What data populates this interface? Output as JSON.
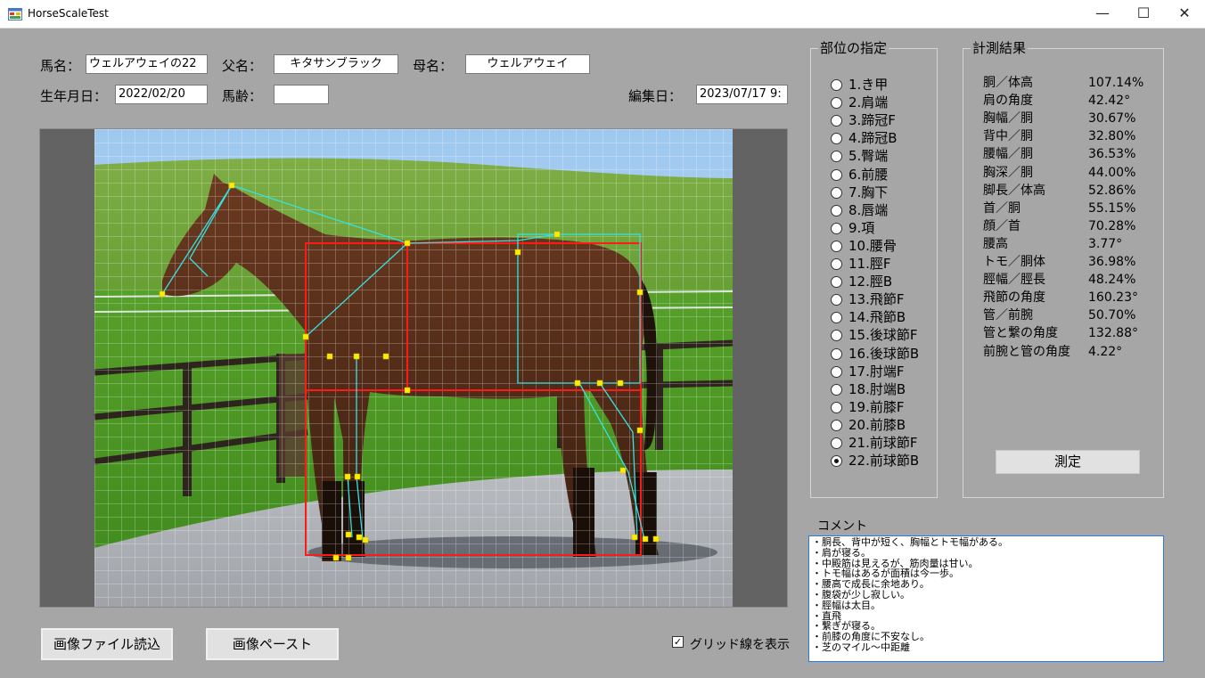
{
  "window": {
    "title": "HorseScaleTest",
    "minimize": "—",
    "maximize": "☐",
    "close": "✕"
  },
  "header": {
    "horse_name_label": "馬名：",
    "horse_name": "ウェルアウェイの22",
    "sire_label": "父名：",
    "sire": "キタサンブラック",
    "dam_label": "母名：",
    "dam": "ウェルアウェイ",
    "birth_label": "生年月日：",
    "birth": "2022/02/20",
    "age_label": "馬齢：",
    "age": "",
    "edit_label": "編集日：",
    "edit_date": "2023/07/17 9:"
  },
  "parts": {
    "title": "部位の指定",
    "selected_index": 21,
    "items": [
      "1.き甲",
      "2.肩端",
      "3.蹄冠F",
      "4.蹄冠B",
      "5.臀端",
      "6.前腰",
      "7.胸下",
      "8.唇端",
      "9.項",
      "10.腰骨",
      "11.脛F",
      "12.脛B",
      "13.飛節F",
      "14.飛節B",
      "15.後球節F",
      "16.後球節B",
      "17.肘端F",
      "18.肘端B",
      "19.前膝F",
      "20.前膝B",
      "21.前球節F",
      "22.前球節B"
    ]
  },
  "results": {
    "title": "計測結果",
    "rows": [
      {
        "name": "胴／体高",
        "value": "107.14%"
      },
      {
        "name": "肩の角度",
        "value": "42.42°"
      },
      {
        "name": "胸幅／胴",
        "value": "30.67%"
      },
      {
        "name": "背中／胴",
        "value": "32.80%"
      },
      {
        "name": "腰幅／胴",
        "value": "36.53%"
      },
      {
        "name": "胸深／胴",
        "value": "44.00%"
      },
      {
        "name": "脚長／体高",
        "value": "52.86%"
      },
      {
        "name": "首／胴",
        "value": "55.15%"
      },
      {
        "name": "顔／首",
        "value": "70.28%"
      },
      {
        "name": "腰高",
        "value": "3.77°"
      },
      {
        "name": "トモ／胴体",
        "value": "36.98%"
      },
      {
        "name": "脛幅／脛長",
        "value": "48.24%"
      },
      {
        "name": "飛節の角度",
        "value": "160.23°"
      },
      {
        "name": "管／前腕",
        "value": "50.70%"
      },
      {
        "name": "管と繋の角度",
        "value": "132.88°"
      },
      {
        "name": "前腕と管の角度",
        "value": "4.22°"
      }
    ],
    "measure_button": "測定"
  },
  "comment": {
    "label": "コメント",
    "lines": [
      "・胴長、背中が短く、胸幅とトモ幅がある。",
      "・肩が寝る。",
      "・中殿筋は見えるが、筋肉量は甘い。",
      "・トモ幅はあるが面積は今一歩。",
      "・腰高で成長に余地あり。",
      "・腹袋が少し寂しい。",
      "・脛幅は太目。",
      "・直飛",
      "・繋ぎが寝る。",
      "・前膝の角度に不安なし。",
      "・芝のマイル～中距離"
    ]
  },
  "bottom": {
    "load_file_button": "画像ファイル読込",
    "paste_button": "画像ペースト",
    "grid_checkbox_label": "グリッド線を表示",
    "grid_checked": true,
    "check_mark": "✓"
  }
}
